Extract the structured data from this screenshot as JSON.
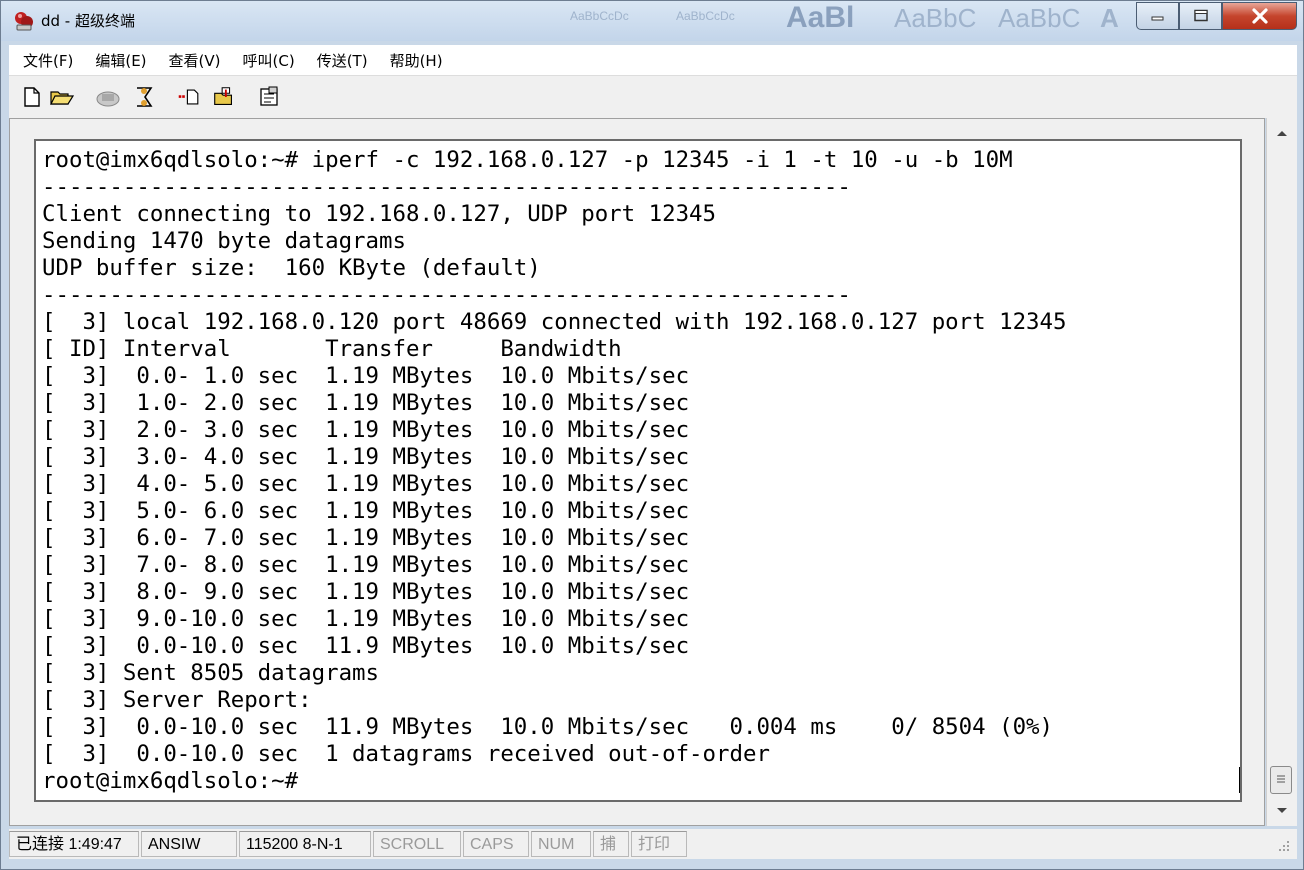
{
  "window": {
    "title": "dd - 超级终端",
    "bg_ribbon": [
      "AaBbCcDc",
      "AaBbCcDc",
      "AaBl",
      "AaBbC",
      "AaBbC",
      "A"
    ]
  },
  "menu": [
    {
      "label": "文件(F)"
    },
    {
      "label": "编辑(E)"
    },
    {
      "label": "查看(V)"
    },
    {
      "label": "呼叫(C)"
    },
    {
      "label": "传送(T)"
    },
    {
      "label": "帮助(H)"
    }
  ],
  "toolbar": {
    "buttons": [
      "new-icon",
      "open-icon",
      "call-icon",
      "disconnect-icon",
      "send-icon",
      "receive-icon",
      "properties-icon"
    ]
  },
  "terminal": {
    "lines": [
      "root@imx6qdlsolo:~# iperf -c 192.168.0.127 -p 12345 -i 1 -t 10 -u -b 10M",
      "------------------------------------------------------------",
      "Client connecting to 192.168.0.127, UDP port 12345",
      "Sending 1470 byte datagrams",
      "UDP buffer size:  160 KByte (default)",
      "------------------------------------------------------------",
      "[  3] local 192.168.0.120 port 48669 connected with 192.168.0.127 port 12345",
      "[ ID] Interval       Transfer     Bandwidth",
      "[  3]  0.0- 1.0 sec  1.19 MBytes  10.0 Mbits/sec",
      "[  3]  1.0- 2.0 sec  1.19 MBytes  10.0 Mbits/sec",
      "[  3]  2.0- 3.0 sec  1.19 MBytes  10.0 Mbits/sec",
      "[  3]  3.0- 4.0 sec  1.19 MBytes  10.0 Mbits/sec",
      "[  3]  4.0- 5.0 sec  1.19 MBytes  10.0 Mbits/sec",
      "[  3]  5.0- 6.0 sec  1.19 MBytes  10.0 Mbits/sec",
      "[  3]  6.0- 7.0 sec  1.19 MBytes  10.0 Mbits/sec",
      "[  3]  7.0- 8.0 sec  1.19 MBytes  10.0 Mbits/sec",
      "[  3]  8.0- 9.0 sec  1.19 MBytes  10.0 Mbits/sec",
      "[  3]  9.0-10.0 sec  1.19 MBytes  10.0 Mbits/sec",
      "[  3]  0.0-10.0 sec  11.9 MBytes  10.0 Mbits/sec",
      "[  3] Sent 8505 datagrams",
      "[  3] Server Report:",
      "[  3]  0.0-10.0 sec  11.9 MBytes  10.0 Mbits/sec   0.004 ms    0/ 8504 (0%)",
      "[  3]  0.0-10.0 sec  1 datagrams received out-of-order",
      "root@imx6qdlsolo:~#"
    ]
  },
  "statusbar": {
    "connection": "已连接 1:49:47",
    "emulation": "ANSIW",
    "settings": "115200 8-N-1",
    "scroll": "SCROLL",
    "caps": "CAPS",
    "num": "NUM",
    "capture": "捕",
    "print": "打印"
  },
  "colors": {
    "titlebar": "#c9d8e8",
    "close_button": "#c5452d",
    "terminal_bg": "#ffffff",
    "terminal_fg": "#000000"
  }
}
